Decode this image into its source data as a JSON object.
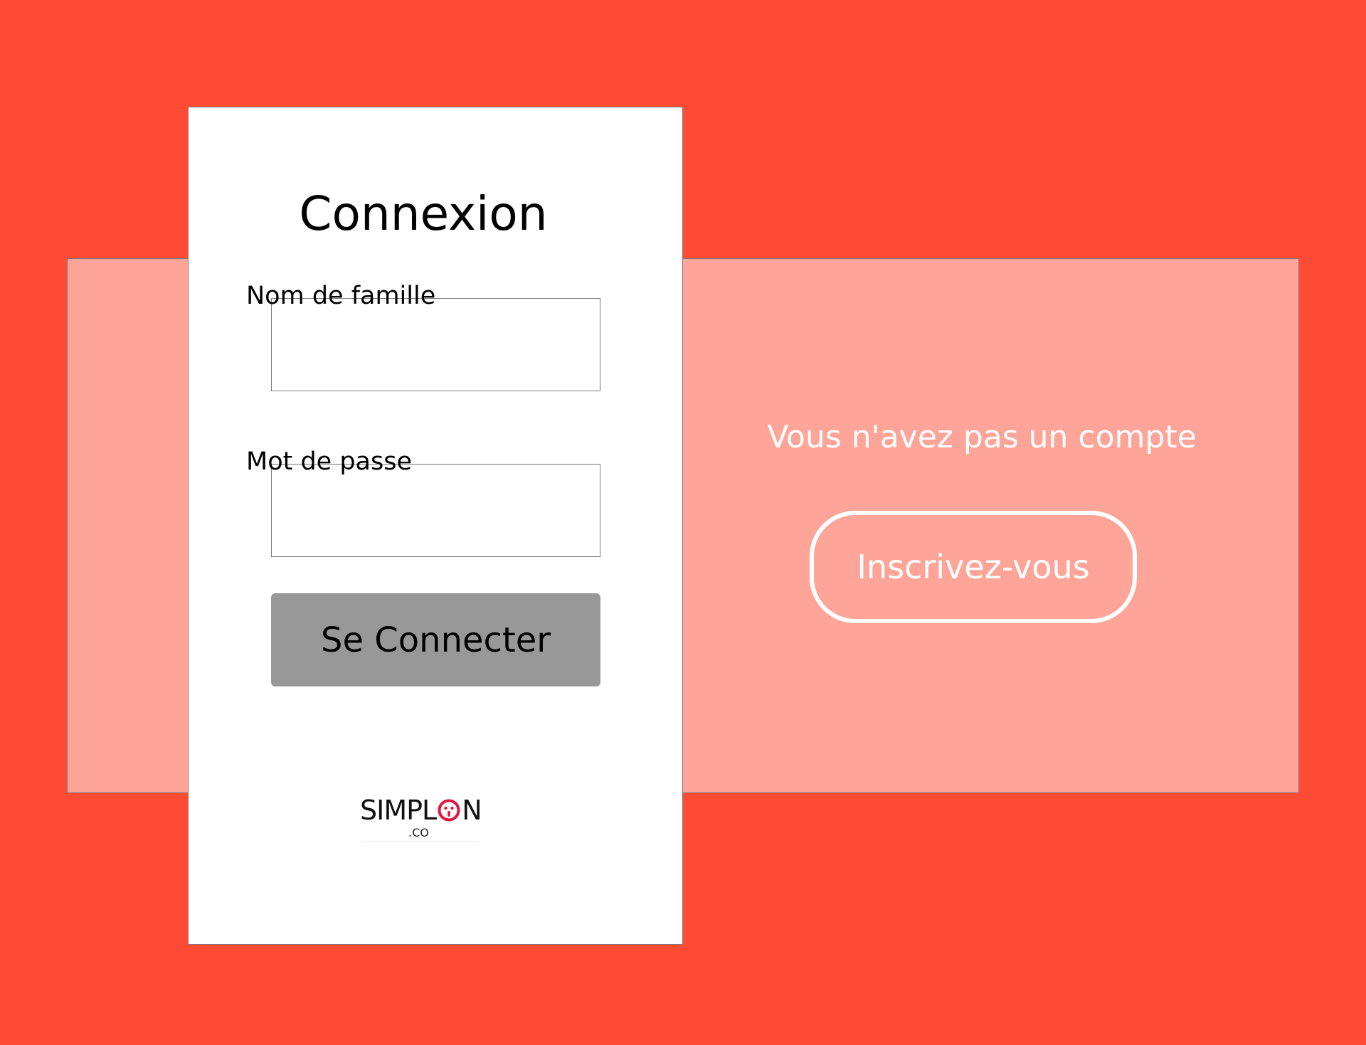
{
  "login": {
    "title": "Connexion",
    "lastname_label": "Nom de famille",
    "lastname_value": "",
    "password_label": "Mot de passe",
    "password_value": "",
    "submit_label": "Se Connecter"
  },
  "signup": {
    "prompt": "Vous n'avez pas un compte",
    "button_label": "Inscrivez-vous"
  },
  "logo": {
    "text": "SIMPLON",
    "sub_text": ".CO",
    "accent_color": "#e3173e"
  },
  "colors": {
    "background": "#ff4b33",
    "panel": "#ffa498",
    "card": "#ffffff",
    "submit_button": "#989898",
    "signup_text": "#ffffff"
  }
}
